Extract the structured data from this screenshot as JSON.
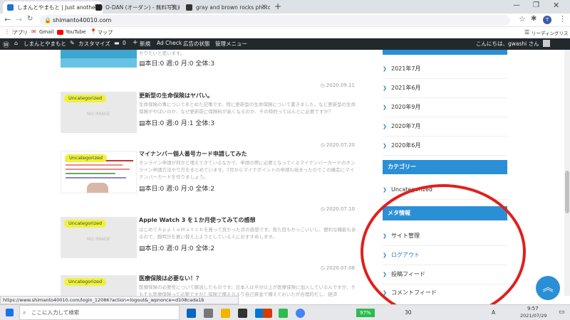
{
  "browser": {
    "tabs": [
      {
        "title": "しまんとやまもと | Just another Wo",
        "fav_color": "#1f6fd6"
      },
      {
        "title": "O-DAN (オーダン) - 無料写真素材",
        "fav_color": "#222222"
      },
      {
        "title": "gray and brown rocks photo – F",
        "fav_color": "#333333"
      }
    ],
    "new_tab": "+",
    "url": "shimanto40010.com",
    "profile_initial": "T",
    "bookmarks": [
      {
        "label": "アプリ"
      },
      {
        "label": "Gmail"
      },
      {
        "label": "YouTube"
      },
      {
        "label": "マップ"
      }
    ],
    "reading_list": "リーディングリスト"
  },
  "wp_admin": {
    "site_name": "しまんとやまもと",
    "customize": "カスタマイズ",
    "comments_count": "0",
    "new": "新規",
    "ad_check": "Ad Check",
    "ad_status": "広告の状態",
    "admin_menu": "管理メニュー",
    "greeting": "こんにちは、gwashi さん"
  },
  "posts": [
    {
      "stats": "本日:0 週:0 月:0 全体:3"
    },
    {
      "date": "2020.09.11",
      "badge": "Uncategorized",
      "thumb_text": "NO IMAGE",
      "title": "更新型の生命保険はヤバい。",
      "excerpt": "生命保険の事についてまとめた記事です。特に更新型の生命保険について書きました。など更新型の生命保険がやばいのか、なぜ更新前に保険料が高くなるのか、その時約ってほんとに必要ですか？",
      "stats": "本日:0 週:0 月:1 全体:3"
    },
    {
      "date": "2020.07.20",
      "badge": "Uncategorized",
      "title": "マイナンバー個人番号カード申請してみた",
      "excerpt": "オンライン申請が何かと増えてきているなかで、申請の際に必要となってくるマイナンバーカードのオンライン申請方法やり方をまとめています。7月からマイナポイントの申請も始まったのでこの機会にマイナンバーカードを作りましょう。",
      "stats": "本日:0 週:0 月:0 全体:2"
    },
    {
      "date": "2020.07.10",
      "badge": "Uncategorized",
      "thumb_text": "NO IMAGE",
      "title": "Apple Watch 3 を１か月使ってみての感想",
      "excerpt": "はじめてＡｐｐｌｅＷａｔｃｈを買って良かった点の感想です。見た目もかっこいいし、便利な機能もあるので、腕時計を買い替え上ようとしている人におすすめします。",
      "stats": "本日:0 週:0 月:0 全体:2"
    },
    {
      "date": "2020.07.08",
      "badge": "Uncategorized",
      "title": "医療保険は必要ない！？",
      "excerpt": "医療保険の必要性について解説したものです。日本人は平分以上が医療保険に加入しているんですが、そもそも医療保険って必要ですか？保険で備えるより自己資金で備えておいたが合理的だし、経済"
    }
  ],
  "sidebar": {
    "archives": [
      {
        "label": "2021年7月"
      },
      {
        "label": "2021年6月"
      },
      {
        "label": "2020年9月"
      },
      {
        "label": "2020年7月"
      },
      {
        "label": "2020年6月"
      }
    ],
    "categories_heading": "カテゴリー",
    "categories": [
      {
        "label": "Uncategorized"
      }
    ],
    "meta_heading": "メタ情報",
    "meta": [
      {
        "label": "サイト管理"
      },
      {
        "label": "ログアウト"
      },
      {
        "label": "投稿フィード"
      },
      {
        "label": "コメントフィード"
      }
    ]
  },
  "status_url": "https://www.shimanto40010.com/login_12086?action=logout&_wpnonce=d108cada1b",
  "taskbar": {
    "search_placeholder": "ここに入力して検索",
    "battery": "97%",
    "temp": "30",
    "ime": "A",
    "time": "9:57",
    "date": "2021/07/29"
  },
  "colors": {
    "accent": "#2b8fd6",
    "badge": "#eef23c",
    "annotation_circle": "#e0201c"
  }
}
